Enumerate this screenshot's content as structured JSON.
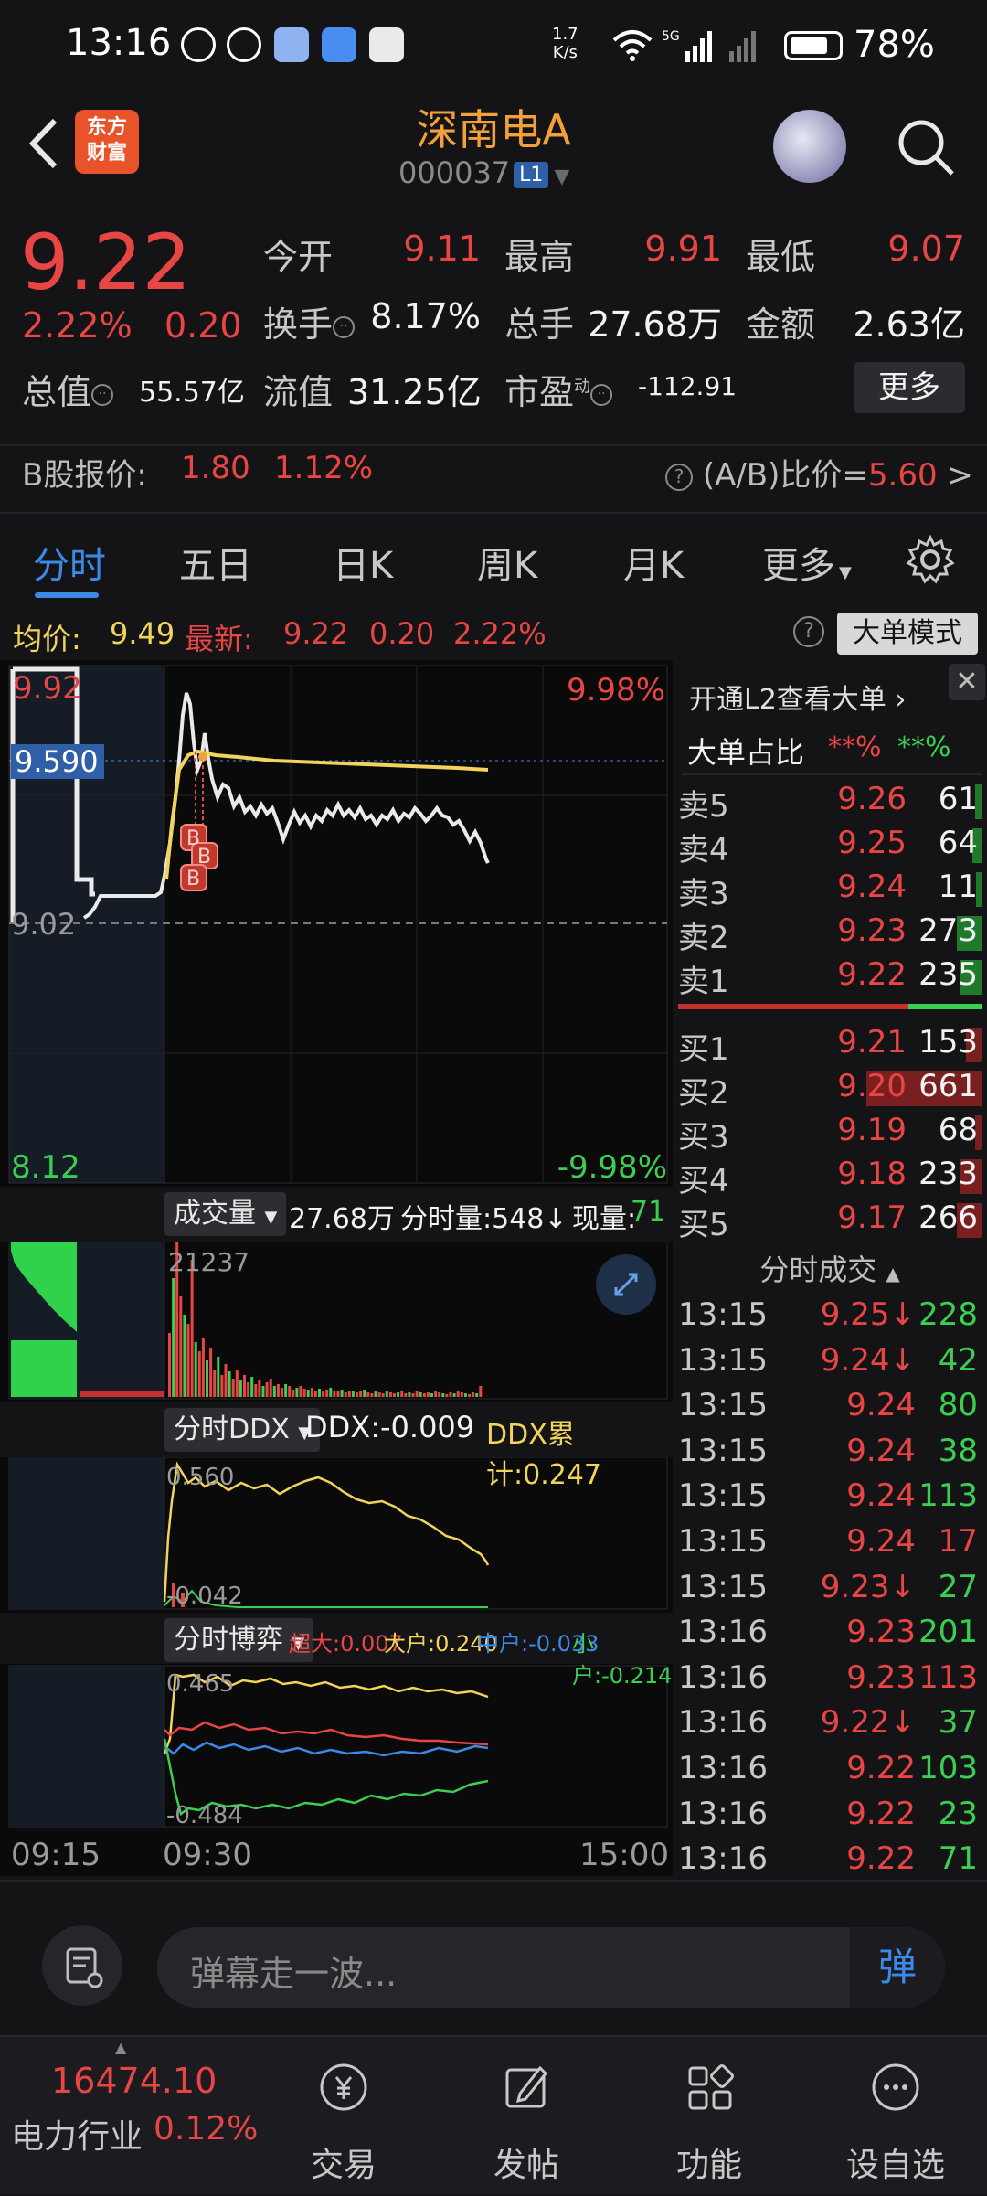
{
  "status_bar": {
    "time": "13:16",
    "net_speed_top": "1.7",
    "net_speed_bottom": "K/s",
    "battery": "78%"
  },
  "header": {
    "logo_line1": "东方",
    "logo_line2": "财富",
    "title": "深南电A",
    "code": "000037",
    "level_badge": "L1"
  },
  "quote": {
    "price": "9.22",
    "change_pct": "2.22%",
    "change": "0.20",
    "open_label": "今开",
    "open": "9.11",
    "high_label": "最高",
    "high": "9.91",
    "low_label": "最低",
    "low": "9.07",
    "turnover_label": "换手",
    "turnover": "8.17%",
    "volume_label": "总手",
    "volume": "27.68万",
    "amount_label": "金额",
    "amount": "2.63亿",
    "mktcap_label": "总值",
    "mktcap": "55.57亿",
    "float_label": "流值",
    "float": "31.25亿",
    "pe_label": "市盈",
    "pe_sup": "动",
    "pe": "-112.91",
    "more_button": "更多",
    "b_label": "B股报价:",
    "b_price": "1.80",
    "b_pct": "1.12%",
    "ab_label": "(A/B)比价=",
    "ab_value": "5.60",
    "ab_arrow": ">"
  },
  "tabs": [
    "分时",
    "五日",
    "日K",
    "周K",
    "月K",
    "更多"
  ],
  "chart_header": {
    "avg_label": "均价:",
    "avg": "9.49",
    "latest_label": "最新:",
    "latest": "9.22",
    "latest_chg": "0.20",
    "latest_pct": "2.22%",
    "mode_button": "大单模式"
  },
  "chart_labels": {
    "top_price": "9.92",
    "top_pct": "9.98%",
    "avg_marker": "9.590",
    "prev_close": "9.02",
    "bottom_price": "8.12",
    "bottom_pct": "-9.98%",
    "vol_select": "成交量",
    "vol_total": "27.68万",
    "vol_min": "分时量:548↓",
    "vol_now_label": "现量:",
    "vol_now": "71",
    "vol_max": "21237",
    "ddx_select": "分时DDX",
    "ddx_value": "DDX:-0.009",
    "ddx_cum": "DDX累计:0.247",
    "ddx_top": "0.560",
    "ddx_bottom": "-0.042",
    "game_select": "分时博弈",
    "game_super": "超大:0.007",
    "game_big": "大户:0.240",
    "game_mid": "中户:-0.033",
    "game_small": "小户:-0.214",
    "game_top": "0.465",
    "game_bottom": "-0.484",
    "time_start": "09:15",
    "time_open": "09:30",
    "time_end": "15:00",
    "buy_marker": "B"
  },
  "right_panel": {
    "l2_link": "开通L2查看大单 ›",
    "big_ratio_label": "大单占比",
    "big_ratio_red": "**%",
    "big_ratio_green": "**%",
    "asks": [
      {
        "label": "卖5",
        "price": "9.26",
        "vol": "61",
        "frac": 0.02,
        "col": "green"
      },
      {
        "label": "卖4",
        "price": "9.25",
        "vol": "64",
        "frac": 0.03,
        "col": "green"
      },
      {
        "label": "卖3",
        "price": "9.24",
        "vol": "11",
        "frac": 0.01,
        "col": "green"
      },
      {
        "label": "卖2",
        "price": "9.23",
        "vol": "273",
        "frac": 0.08,
        "col": "green"
      },
      {
        "label": "卖1",
        "price": "9.22",
        "vol": "235",
        "frac": 0.07,
        "col": "green"
      }
    ],
    "bids": [
      {
        "label": "买1",
        "price": "9.21",
        "vol": "153",
        "frac": 0.05,
        "col": "red"
      },
      {
        "label": "买2",
        "price": "9.20",
        "vol": "661",
        "frac": 0.38,
        "col": "red"
      },
      {
        "label": "买3",
        "price": "9.19",
        "vol": "68",
        "frac": 0.02,
        "col": "red"
      },
      {
        "label": "买4",
        "price": "9.18",
        "vol": "233",
        "frac": 0.07,
        "col": "red"
      },
      {
        "label": "买5",
        "price": "9.17",
        "vol": "266",
        "frac": 0.08,
        "col": "red"
      }
    ],
    "trades_title": "分时成交",
    "trades": [
      {
        "time": "13:15",
        "price": "9.25↓",
        "vol": "228",
        "vcol": "green"
      },
      {
        "time": "13:15",
        "price": "9.24↓",
        "vol": "42",
        "vcol": "green"
      },
      {
        "time": "13:15",
        "price": "9.24",
        "vol": "80",
        "vcol": "green"
      },
      {
        "time": "13:15",
        "price": "9.24",
        "vol": "38",
        "vcol": "green"
      },
      {
        "time": "13:15",
        "price": "9.24",
        "vol": "113",
        "vcol": "green"
      },
      {
        "time": "13:15",
        "price": "9.24",
        "vol": "17",
        "vcol": "red"
      },
      {
        "time": "13:15",
        "price": "9.23↓",
        "vol": "27",
        "vcol": "green"
      },
      {
        "time": "13:16",
        "price": "9.23",
        "vol": "201",
        "vcol": "green"
      },
      {
        "time": "13:16",
        "price": "9.23",
        "vol": "113",
        "vcol": "red"
      },
      {
        "time": "13:16",
        "price": "9.22↓",
        "vol": "37",
        "vcol": "green"
      },
      {
        "time": "13:16",
        "price": "9.22",
        "vol": "103",
        "vcol": "green"
      },
      {
        "time": "13:16",
        "price": "9.22",
        "vol": "23",
        "vcol": "green"
      },
      {
        "time": "13:16",
        "price": "9.22",
        "vol": "71",
        "vcol": "green"
      }
    ]
  },
  "comment": {
    "placeholder": "弹幕走一波...",
    "send": "弹"
  },
  "bottom_nav": {
    "index_value": "16474.10",
    "index_name": "电力行业",
    "index_pct": "0.12%",
    "items": [
      {
        "label": "交易",
        "icon": "yen-icon"
      },
      {
        "label": "发帖",
        "icon": "edit-icon"
      },
      {
        "label": "功能",
        "icon": "grid-icon"
      },
      {
        "label": "设自选",
        "icon": "more-icon"
      }
    ]
  },
  "colors": {
    "red": "#e84545",
    "green": "#3bcf52",
    "yellow": "#f2d35c",
    "accent": "#3c8ae8",
    "brand": "#e8532a",
    "title": "#f2a13a"
  }
}
